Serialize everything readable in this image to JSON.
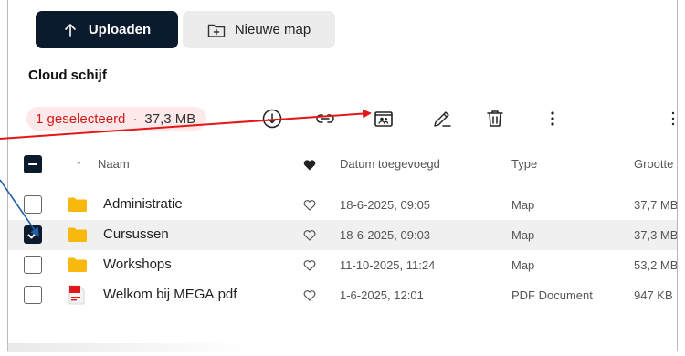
{
  "buttons": {
    "upload": "Uploaden",
    "new_folder": "Nieuwe map"
  },
  "location_title": "Cloud schijf",
  "selection": {
    "count_label": "1 geselecteerd",
    "separator": "·",
    "size": "37,3 MB"
  },
  "toolbar_icons": [
    "download-icon",
    "link-icon",
    "share-folder-icon",
    "rename-icon",
    "trash-icon",
    "more-icon",
    "list-view-icon"
  ],
  "table": {
    "columns": {
      "sort_arrow": "↑",
      "name": "Naam",
      "date": "Datum toegevoegd",
      "type": "Type",
      "size": "Grootte"
    },
    "rows": [
      {
        "name": "Administratie",
        "date": "18-6-2025, 09:05",
        "type": "Map",
        "size": "37,7 MB",
        "icon": "folder-icon",
        "checked": false
      },
      {
        "name": "Cursussen",
        "date": "18-6-2025, 09:03",
        "type": "Map",
        "size": "37,3 MB",
        "icon": "folder-icon",
        "checked": true
      },
      {
        "name": "Workshops",
        "date": "11-10-2025, 11:24",
        "type": "Map",
        "size": "53,2 MB",
        "icon": "folder-icon",
        "checked": false
      },
      {
        "name": "Welkom bij MEGA.pdf",
        "date": "1-6-2025, 12:01",
        "type": "PDF Document",
        "size": "947 KB",
        "icon": "pdf-icon",
        "checked": false
      }
    ]
  },
  "colors": {
    "primary": "#0c1a2e",
    "accent_red": "#d11b1b",
    "folder": "#f9b80d",
    "annotation_blue": "#1f5fa8",
    "annotation_red": "#e01818"
  }
}
